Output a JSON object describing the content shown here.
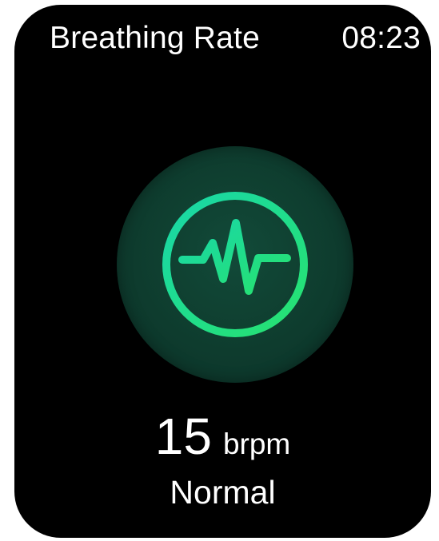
{
  "header": {
    "title": "Breathing Rate",
    "time": "08:23"
  },
  "icon": {
    "name": "heartbeat-icon",
    "accent_start": "#19d7a8",
    "accent_end": "#27e26f",
    "background": "#0f3f30"
  },
  "reading": {
    "value": "15",
    "unit": "brpm",
    "status": "Normal"
  }
}
